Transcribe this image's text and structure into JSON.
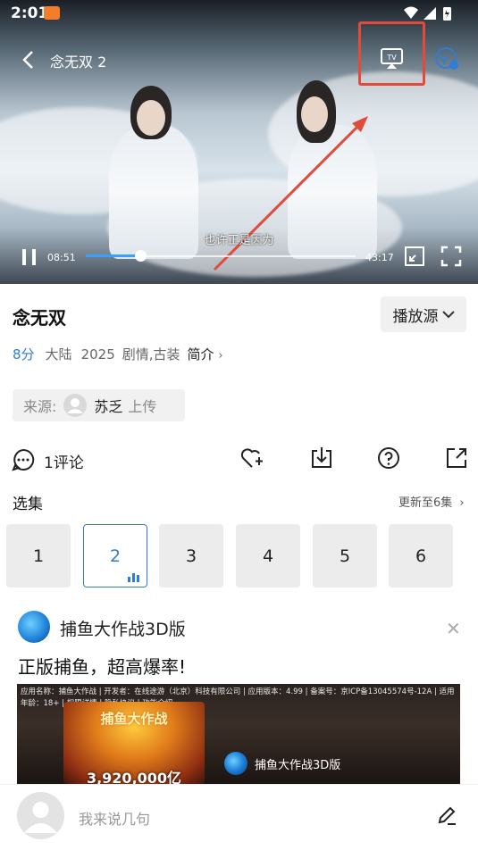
{
  "status_bar": {
    "time": "2:01"
  },
  "player": {
    "title": "念无双 2",
    "subtitle": "也许正是因为",
    "current_time": "08:51",
    "total_time": "43:17",
    "progress": 0.2,
    "cast_icon": "tv-cast-icon",
    "accent_color": "#3aa0ff",
    "highlight_color": "#e24a3b"
  },
  "info": {
    "title": "念无双",
    "source_button": "播放源",
    "score": "8分",
    "region": "大陆",
    "year": "2025",
    "genres": "剧情,古装",
    "intro": "简介"
  },
  "uploader": {
    "label": "来源:",
    "name": "苏乏",
    "suffix": "上传"
  },
  "actions": {
    "comments": "1评论"
  },
  "episodes": {
    "title": "选集",
    "update": "更新至6集",
    "items": [
      "1",
      "2",
      "3",
      "4",
      "5",
      "6"
    ],
    "selected": "2"
  },
  "ad": {
    "name": "捕鱼大作战3D版",
    "slogan": "正版捕鱼，超高爆率!",
    "info": "应用名称：捕鱼大作战 | 开发者：在线途游（北京）科技有限公司 | 应用版本：4.99 | 备案号：京ICP备13045574号-12A | 适用年龄：18+ | 权限详情 | 隐私协议 | 功能介绍",
    "game_title": "捕鱼大作战",
    "game_number": "3,920,000亿",
    "brand": "捕鱼大作战3D版"
  },
  "comment_bar": {
    "placeholder": "我来说几句"
  }
}
